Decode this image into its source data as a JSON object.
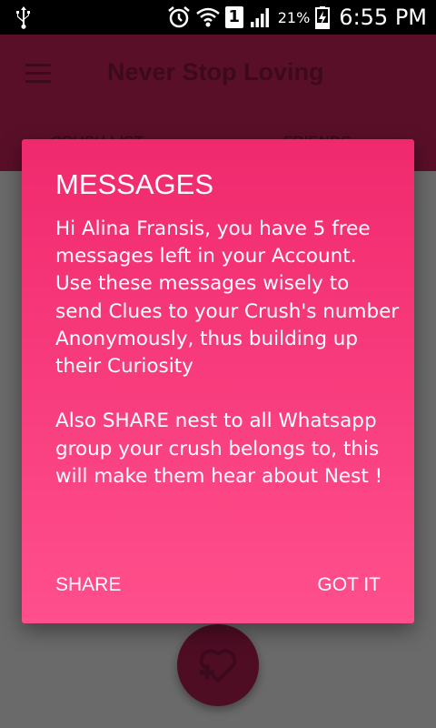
{
  "status_bar": {
    "battery_percent": "21%",
    "time": "6:55 PM",
    "sim_slot": "1",
    "icons": [
      "usb-icon",
      "alarm-icon",
      "wifi-icon",
      "sim-icon",
      "signal-icon",
      "battery-charging-icon"
    ]
  },
  "app_bar": {
    "title": "Never Stop Loving",
    "tabs": [
      {
        "label": "CRUSH LIST"
      },
      {
        "label": "FRIENDS"
      }
    ]
  },
  "dialog": {
    "title": "MESSAGES",
    "body": "Hi Alina Fransis, you have 5 free messages left in your Account.\nUse these messages wisely to send Clues to your Crush's number Anonymously, thus building up their Curiosity\n\nAlso SHARE nest to all Whatsapp group your crush belongs to, this will make them hear about Nest !",
    "share_label": "SHARE",
    "got_it_label": "GOT IT"
  },
  "fab": {
    "icon": "heart-plus-icon"
  },
  "colors": {
    "app_bar": "#8a1840",
    "dialog_top": "#f0296d",
    "dialog_bottom": "#ff4f8c",
    "fab": "#7a1538"
  }
}
